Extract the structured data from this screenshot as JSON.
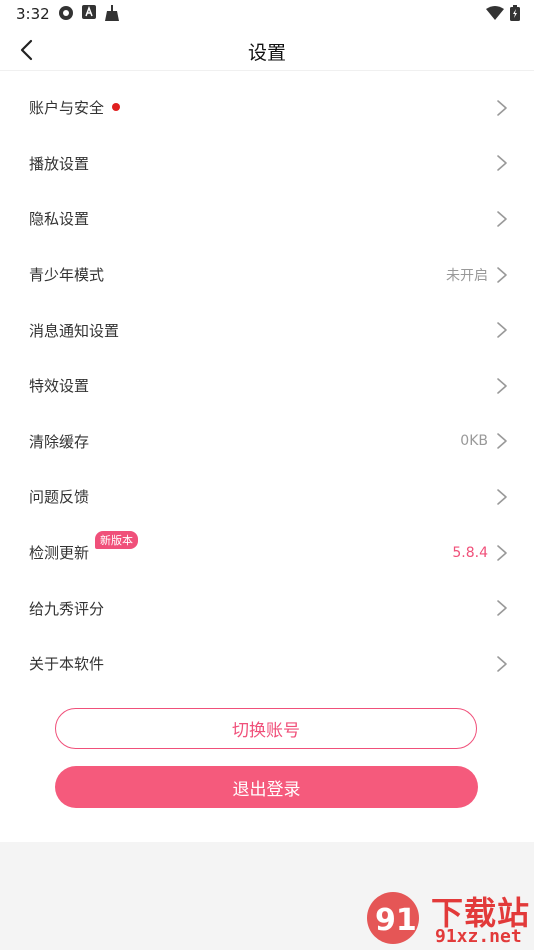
{
  "status_bar": {
    "time": "3:32"
  },
  "nav": {
    "title": "设置"
  },
  "items": [
    {
      "label": "账户与安全",
      "value": "",
      "dot": true
    },
    {
      "label": "播放设置",
      "value": ""
    },
    {
      "label": "隐私设置",
      "value": ""
    },
    {
      "label": "青少年模式",
      "value": "未开启"
    },
    {
      "label": "消息通知设置",
      "value": ""
    },
    {
      "label": "特效设置",
      "value": ""
    },
    {
      "label": "清除缓存",
      "value": "0KB"
    },
    {
      "label": "问题反馈",
      "value": ""
    },
    {
      "label": "检测更新",
      "value": "5.8.4",
      "badge": "新版本"
    },
    {
      "label": "给九秀评分",
      "value": ""
    },
    {
      "label": "关于本软件",
      "value": ""
    }
  ],
  "buttons": {
    "switch_account": "切换账号",
    "logout": "退出登录"
  },
  "watermark": {
    "line1": "下载站",
    "line2": "91xz.net"
  },
  "colors": {
    "accent": "#f55a7c",
    "dot": "#e02020"
  }
}
